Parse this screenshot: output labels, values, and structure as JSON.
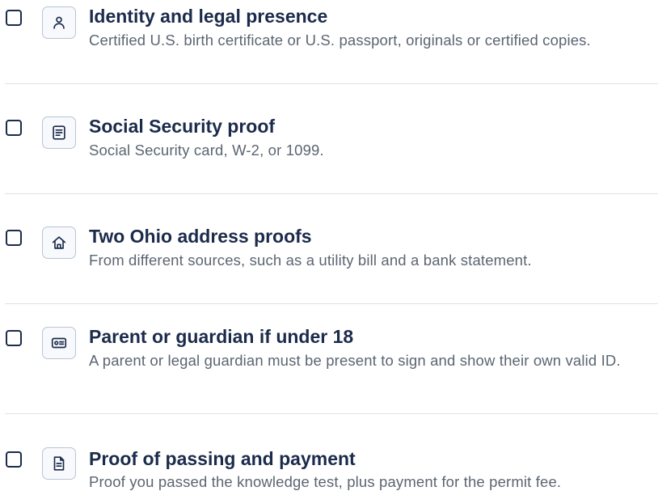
{
  "checklist": {
    "items": [
      {
        "title": "Identity and legal presence",
        "description": "Certified U.S. birth certificate or U.S. passport, originals or certified copies.",
        "icon": "person-icon",
        "checked": false
      },
      {
        "title": "Social Security proof",
        "description": "Social Security card, W-2, or 1099.",
        "icon": "document-lines-icon",
        "checked": false
      },
      {
        "title": "Two Ohio address proofs",
        "description": "From different sources, such as a utility bill and a bank statement.",
        "icon": "home-icon",
        "checked": false
      },
      {
        "title": "Parent or guardian if under 18",
        "description": "A parent or legal guardian must be present to sign and show their own valid ID.",
        "icon": "id-card-icon",
        "checked": false
      },
      {
        "title": "Proof of passing and payment",
        "description": "Proof you passed the knowledge test, plus payment for the permit fee.",
        "icon": "file-text-icon",
        "checked": false
      }
    ]
  },
  "colors": {
    "title": "#1b2b4b",
    "description": "#5c6572",
    "icon_stroke": "#1b2b4b",
    "icon_border": "#b9c4d3",
    "divider": "#dde2ea"
  }
}
